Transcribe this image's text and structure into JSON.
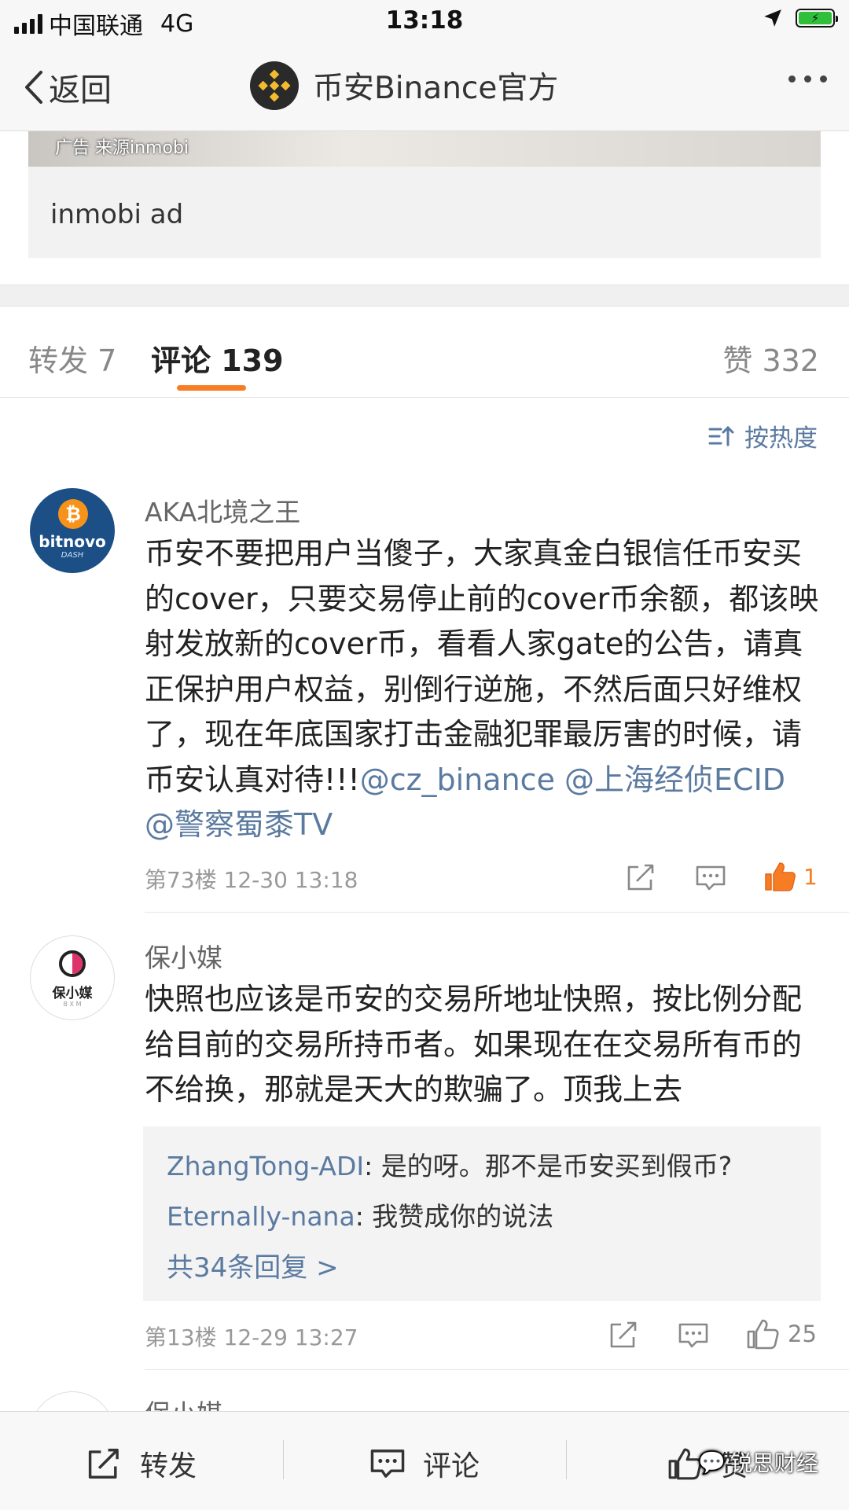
{
  "status_bar": {
    "carrier": "中国联通",
    "network": "4G",
    "time": "13:18"
  },
  "nav": {
    "back_label": "返回",
    "title": "币安Binance官方",
    "brand_color": "#f3ba2f"
  },
  "ad": {
    "source": "广告 来源inmobi",
    "text": "inmobi ad"
  },
  "tabs": [
    {
      "label": "转发 7"
    },
    {
      "label": "评论 139",
      "active": true
    },
    {
      "label": "赞 332"
    }
  ],
  "sort": {
    "label": "按热度"
  },
  "comments": [
    {
      "avatar_text": "bitnovo",
      "avatar_sub": "DASH",
      "user": "AKA北境之王",
      "text": "币安不要把用户当傻子，大家真金白银信任币安买的cover，只要交易停止前的cover币余额，都该映射发放新的cover币，看看人家gate的公告，请真正保护用户权益，别倒行逆施，不然后面只好维权了，现在年底国家打击金融犯罪最厉害的时候，请币安认真对待!!!",
      "mentions": "@cz_binance @上海经侦ECID @警察蜀黍TV",
      "floor_time": "第73楼 12-30 13:18",
      "likes": "1",
      "liked": true
    },
    {
      "avatar_text": "保小媒",
      "avatar_sub": "B X M",
      "user": "保小媒",
      "text": "快照也应该是币安的交易所地址快照，按比例分配给目前的交易所持币者。如果现在在交易所有币的不给换，那就是天大的欺骗了。顶我上去",
      "replies": [
        {
          "name": "ZhangTong-ADI",
          "text": ": 是的呀。那不是币安买到假币?"
        },
        {
          "name": "Eternally-nana",
          "text": ": 我赞成你的说法"
        }
      ],
      "more_replies": "共34条回复 >",
      "floor_time": "第13楼 12-29 13:27",
      "likes": "25",
      "liked": false
    },
    {
      "user": "保小媒"
    }
  ],
  "bottom_bar": {
    "repost": "转发",
    "comment": "评论",
    "like": "赞"
  },
  "watermark": "锐思财经",
  "colors": {
    "accent_orange": "#f77d25",
    "link_blue": "#5b7aa0"
  }
}
